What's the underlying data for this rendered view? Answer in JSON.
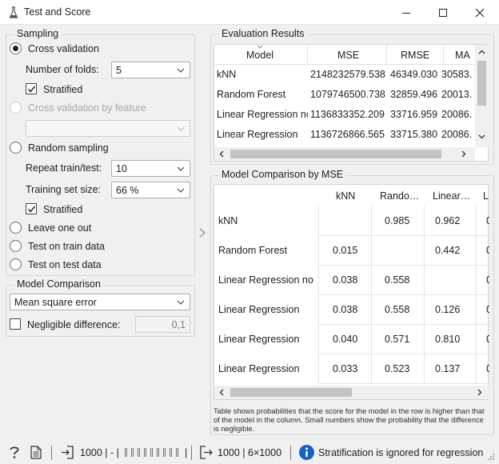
{
  "window": {
    "title": "Test and Score"
  },
  "sampling": {
    "legend": "Sampling",
    "cross_validation": "Cross validation",
    "folds_label": "Number of folds:",
    "folds_value": "5",
    "stratified_1": "Stratified",
    "cv_by_feature": "Cross validation by feature",
    "random_sampling": "Random sampling",
    "repeat_label": "Repeat train/test:",
    "repeat_value": "10",
    "train_size_label": "Training set size:",
    "train_size_value": "66 %",
    "stratified_2": "Stratified",
    "leave_one_out": "Leave one out",
    "test_on_train": "Test on train data",
    "test_on_test": "Test on test data"
  },
  "comparison": {
    "legend": "Model Comparison",
    "metric": "Mean square error",
    "negligible_label": "Negligible difference:",
    "negligible_value": "0,1"
  },
  "evaluation": {
    "legend": "Evaluation Results",
    "headers": [
      "Model",
      "MSE",
      "RMSE",
      "MA"
    ],
    "rows": [
      [
        "kNN",
        "2148232579.538",
        "46349.030",
        "30583."
      ],
      [
        "Random Forest",
        "1079746500.738",
        "32859.496",
        "20013."
      ],
      [
        "Linear Regression no",
        "1136833352.209",
        "33716.959",
        "20086."
      ],
      [
        "Linear Regression",
        "1136726866.565",
        "33715.380",
        "20086."
      ]
    ]
  },
  "model_comparison": {
    "legend": "Model Comparison by MSE",
    "col_headers": [
      "kNN",
      "Rando…",
      "Linear…",
      "L"
    ],
    "rows": [
      {
        "label": "kNN",
        "cells": [
          "",
          "0.985",
          "0.962",
          "0"
        ]
      },
      {
        "label": "Random Forest",
        "cells": [
          "0.015",
          "",
          "0.442",
          "0"
        ]
      },
      {
        "label": "Linear Regression no",
        "cells": [
          "0.038",
          "0.558",
          "",
          "0"
        ]
      },
      {
        "label": "Linear Regression",
        "cells": [
          "0.038",
          "0.558",
          "0.126",
          "0"
        ]
      },
      {
        "label": "Linear Regression",
        "cells": [
          "0.040",
          "0.571",
          "0.810",
          "0"
        ]
      },
      {
        "label": "Linear Regression",
        "cells": [
          "0.033",
          "0.523",
          "0.137",
          "0"
        ]
      }
    ],
    "note": "Table shows probabilities that the score for the model in the row is higher than that of the model in the column. Small numbers show the probability that the difference is negligible."
  },
  "status": {
    "input_summary": "1000 | - |",
    "input_tail": "|",
    "output_summary": "1000 | 6×1000",
    "message": "Stratification is ignored for regression"
  },
  "icons": [
    "flask-icon",
    "minimize-icon",
    "maximize-icon",
    "close-icon",
    "help-icon",
    "report-icon",
    "input-icon",
    "output-icon",
    "info-icon"
  ]
}
